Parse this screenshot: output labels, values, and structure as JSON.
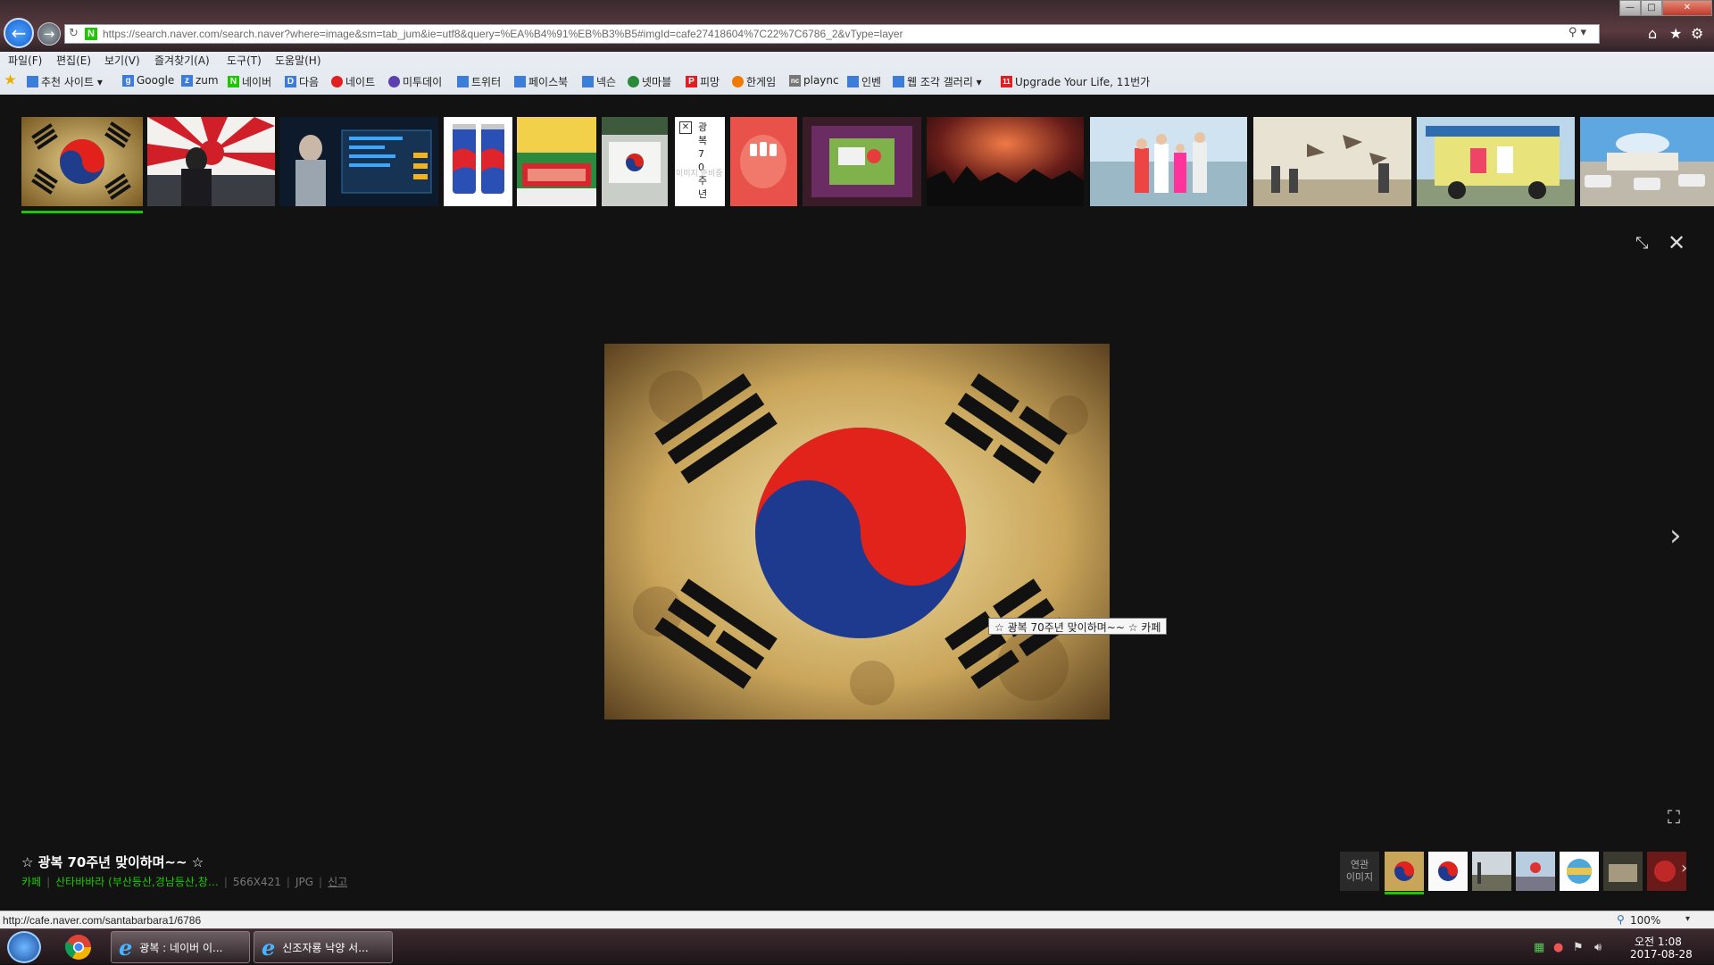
{
  "browser": {
    "url": "https://search.naver.com/search.naver?where=image&sm=tab_jum&ie=utf8&query=%EA%B4%91%EB%B3%B5#imgId=cafe27418604%7C22%7C6786_2&vType=layer",
    "menu": [
      "파일(F)",
      "편집(E)",
      "보기(V)",
      "즐겨찾기(A)",
      "도구(T)",
      "도움말(H)"
    ],
    "favorites": [
      {
        "label": "추천 사이트 ▾",
        "icon": "page-icon",
        "color": "#3c7dd9"
      },
      {
        "label": "Google",
        "icon": "google-icon",
        "color": "#3c7dd9"
      },
      {
        "label": "zum",
        "icon": "zum-icon",
        "color": "#3c7dd9"
      },
      {
        "label": "네이버",
        "icon": "naver-icon",
        "color": "#1ec800"
      },
      {
        "label": "다음",
        "icon": "daum-icon",
        "color": "#3c7dd9"
      },
      {
        "label": "네이트",
        "icon": "nate-icon",
        "color": "#e02020"
      },
      {
        "label": "미투데이",
        "icon": "me2day-icon",
        "color": "#5c3fb0"
      },
      {
        "label": "트위터",
        "icon": "page-icon",
        "color": "#3c7dd9"
      },
      {
        "label": "페이스북",
        "icon": "page-icon",
        "color": "#3c7dd9"
      },
      {
        "label": "넥슨",
        "icon": "page-icon",
        "color": "#3c7dd9"
      },
      {
        "label": "넷마블",
        "icon": "netmarble-icon",
        "color": "#2a8a3a"
      },
      {
        "label": "피망",
        "icon": "pmang-icon",
        "color": "#e02020"
      },
      {
        "label": "한게임",
        "icon": "hangame-icon",
        "color": "#f07a00"
      },
      {
        "label": "plaync",
        "icon": "plaync-icon",
        "color": "#777777"
      },
      {
        "label": "인벤",
        "icon": "page-icon",
        "color": "#3c7dd9"
      },
      {
        "label": "웹 조각 갤러리 ▾",
        "icon": "page-icon",
        "color": "#3c7dd9"
      },
      {
        "label": "Upgrade Your Life, 11번가",
        "icon": "11st-icon",
        "color": "#e02020"
      }
    ]
  },
  "viewer": {
    "tooltip": "☆ 광복 70주년 맞이하며~~ ☆ 카페",
    "title": "☆ 광복 70주년 맞이하며~~ ☆",
    "source_type": "카페",
    "source_name": "산타바바라 (부산등산,경남등산,창…",
    "dimensions": "566X421",
    "format": "JPG",
    "report": "신고",
    "related_label_1": "연관",
    "related_label_2": "이미지",
    "strip_text_thumb": "광복 70 주년",
    "strip_text_caption": "이미지 준비중"
  },
  "status": {
    "url": "http://cafe.naver.com/santabarbara1/6786",
    "zoom": "100%"
  },
  "taskbar": {
    "tasks": [
      "광복 : 네이버 이...",
      "신조자룡 낙양 서..."
    ],
    "time": "오전 1:08",
    "date": "2017-08-28"
  }
}
